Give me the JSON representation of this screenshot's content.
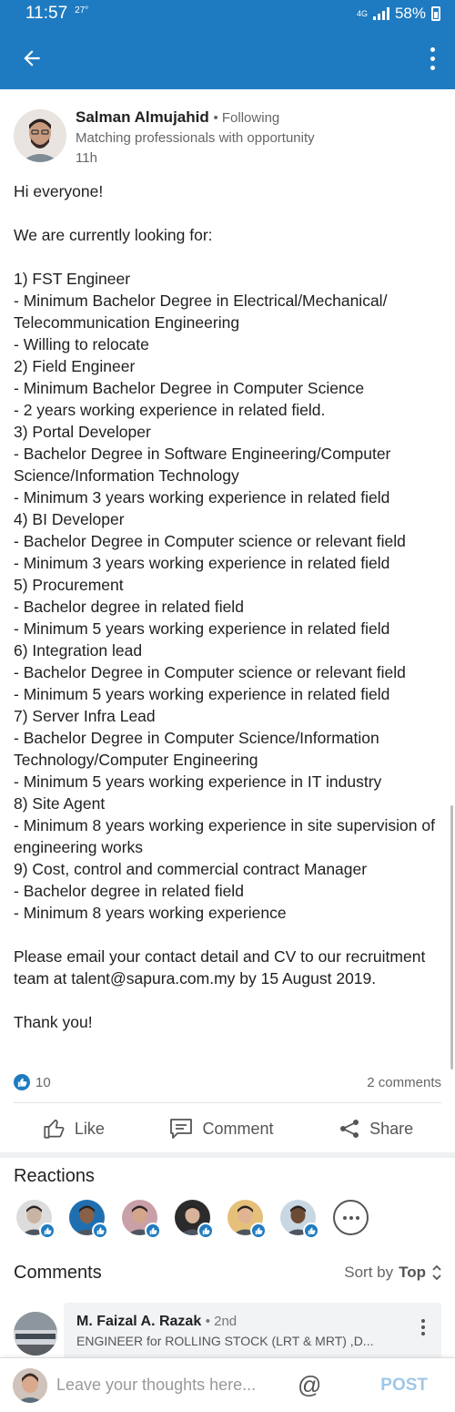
{
  "status_bar": {
    "time": "11:57",
    "temp": "27°",
    "network": "4G",
    "battery": "58%"
  },
  "post": {
    "author_name": "Salman Almujahid",
    "follow_status": "• Following",
    "headline": "Matching professionals with opportunity",
    "time": "11h",
    "lines": [
      "Hi everyone!",
      "",
      "We are currently looking for:",
      "",
      "1) FST Engineer",
      "- Minimum Bachelor Degree in Electrical/Mechanical/ Telecommunication Engineering",
      "- Willing to relocate",
      "2) Field Engineer",
      "- Minimum Bachelor Degree in Computer Science",
      "- 2 years working experience in related field.",
      "3) Portal Developer",
      "- Bachelor Degree in Software Engineering/Computer Science/Information Technology",
      "- Minimum 3 years working experience in related field",
      "4) BI Developer",
      "- Bachelor Degree in Computer science or relevant field",
      "- Minimum 3 years working experience in related field",
      "5) Procurement",
      "- Bachelor degree in related field",
      "- Minimum 5 years working experience in related field",
      "6) Integration lead",
      "- Bachelor Degree in Computer science or relevant field",
      "- Minimum 5 years working experience in related field",
      "7) Server Infra Lead",
      "- Bachelor Degree in Computer Science/Information Technology/Computer Engineering",
      "- Minimum 5 years working experience in IT industry",
      "8) Site Agent",
      "- Minimum 8 years working experience in site supervision of engineering works",
      "9) Cost, control and commercial contract Manager",
      "- Bachelor degree in related field",
      "- Minimum 8 years working experience",
      "",
      "Please email your contact detail and CV to our recruitment team at talent@sapura.com.my by 15 August 2019.",
      "",
      "Thank you!"
    ],
    "likes_count": "10",
    "comments_count": "2 comments"
  },
  "actions": {
    "like": "Like",
    "comment": "Comment",
    "share": "Share"
  },
  "reactions": {
    "title": "Reactions",
    "reactors": [
      {
        "icon": "avatar-1",
        "skin": "#c9b4a3",
        "bg": "#dcdcdc"
      },
      {
        "icon": "avatar-2",
        "skin": "#8a6048",
        "bg": "#1f6fb0"
      },
      {
        "icon": "avatar-3",
        "skin": "#d3a58b",
        "bg": "#c9a0a8"
      },
      {
        "icon": "avatar-4",
        "skin": "#d8b29a",
        "bg": "#2b2b2b"
      },
      {
        "icon": "avatar-5",
        "skin": "#e0b492",
        "bg": "#e5c07a"
      },
      {
        "icon": "avatar-6",
        "skin": "#6d4a33",
        "bg": "#c8d7e2"
      }
    ]
  },
  "comments": {
    "title": "Comments",
    "sort_label": "Sort by",
    "sort_value": "Top",
    "items": [
      {
        "name": "M. Faizal A. Razak",
        "degree": "• 2nd",
        "headline": "ENGINEER for ROLLING STOCK (LRT & MRT) ,D..."
      }
    ]
  },
  "composer": {
    "placeholder": "Leave your thoughts here...",
    "post_label": "POST"
  },
  "colors": {
    "brand": "#1f7bc1",
    "post_disabled": "#9fc7e8"
  }
}
